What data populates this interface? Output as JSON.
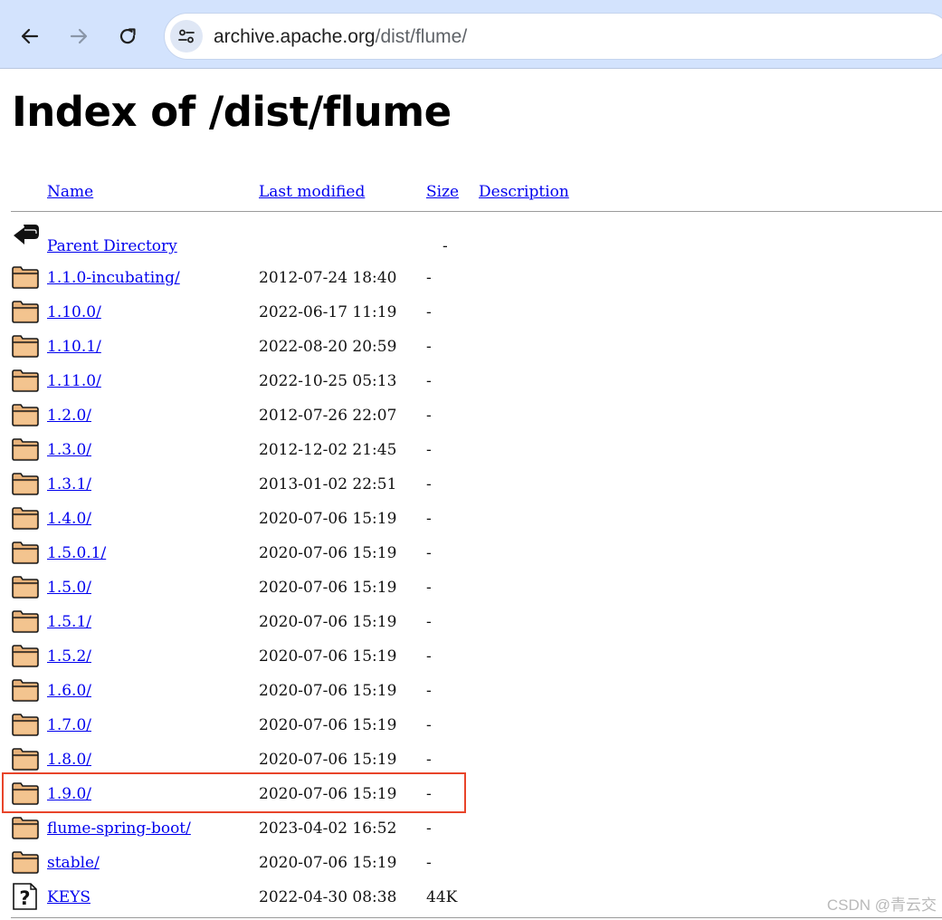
{
  "browser": {
    "url_host": "archive.apache.org",
    "url_path": "/dist/flume/",
    "icons": {
      "back": "arrow-left-icon",
      "forward": "arrow-right-icon",
      "reload": "reload-icon",
      "site_info": "tune-icon"
    }
  },
  "page": {
    "title": "Index of /dist/flume",
    "columns": {
      "name": "Name",
      "modified": "Last modified",
      "size": "Size",
      "description": "Description"
    },
    "parent": {
      "label": "Parent Directory",
      "size": "-"
    },
    "rows": [
      {
        "name": "1.1.0-incubating/",
        "date": "2012-07-24 18:40",
        "size": "-",
        "type": "folder"
      },
      {
        "name": "1.10.0/",
        "date": "2022-06-17 11:19",
        "size": "-",
        "type": "folder"
      },
      {
        "name": "1.10.1/",
        "date": "2022-08-20 20:59",
        "size": "-",
        "type": "folder"
      },
      {
        "name": "1.11.0/",
        "date": "2022-10-25 05:13",
        "size": "-",
        "type": "folder"
      },
      {
        "name": "1.2.0/",
        "date": "2012-07-26 22:07",
        "size": "-",
        "type": "folder"
      },
      {
        "name": "1.3.0/",
        "date": "2012-12-02 21:45",
        "size": "-",
        "type": "folder"
      },
      {
        "name": "1.3.1/",
        "date": "2013-01-02 22:51",
        "size": "-",
        "type": "folder"
      },
      {
        "name": "1.4.0/",
        "date": "2020-07-06 15:19",
        "size": "-",
        "type": "folder"
      },
      {
        "name": "1.5.0.1/",
        "date": "2020-07-06 15:19",
        "size": "-",
        "type": "folder"
      },
      {
        "name": "1.5.0/",
        "date": "2020-07-06 15:19",
        "size": "-",
        "type": "folder"
      },
      {
        "name": "1.5.1/",
        "date": "2020-07-06 15:19",
        "size": "-",
        "type": "folder"
      },
      {
        "name": "1.5.2/",
        "date": "2020-07-06 15:19",
        "size": "-",
        "type": "folder"
      },
      {
        "name": "1.6.0/",
        "date": "2020-07-06 15:19",
        "size": "-",
        "type": "folder"
      },
      {
        "name": "1.7.0/",
        "date": "2020-07-06 15:19",
        "size": "-",
        "type": "folder"
      },
      {
        "name": "1.8.0/",
        "date": "2020-07-06 15:19",
        "size": "-",
        "type": "folder"
      },
      {
        "name": "1.9.0/",
        "date": "2020-07-06 15:19",
        "size": "-",
        "type": "folder",
        "highlighted": true
      },
      {
        "name": "flume-spring-boot/",
        "date": "2023-04-02 16:52",
        "size": "-",
        "type": "folder"
      },
      {
        "name": "stable/",
        "date": "2020-07-06 15:19",
        "size": "-",
        "type": "folder"
      },
      {
        "name": "KEYS",
        "date": "2022-04-30 08:38",
        "size": "44K",
        "type": "unknown-file"
      }
    ],
    "highlight_color": "#e8442a"
  },
  "watermark": "CSDN @青云交"
}
